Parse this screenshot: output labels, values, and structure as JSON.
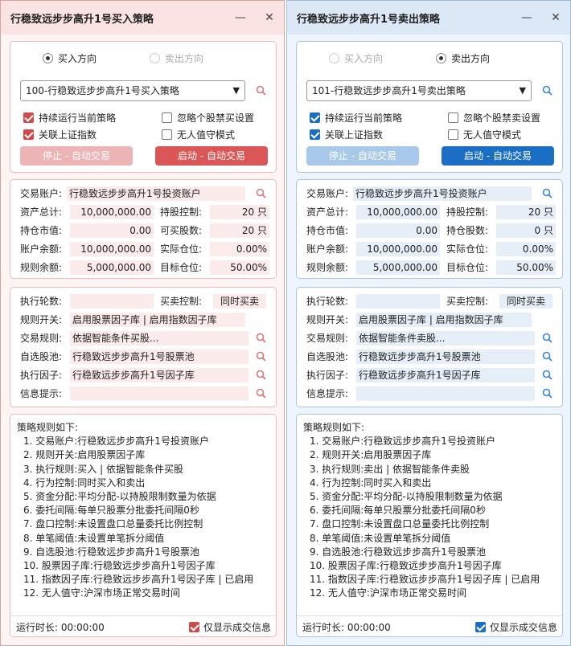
{
  "buy": {
    "title": "行稳致远步步高升1号买入策略",
    "minimize": "—",
    "close": "✕",
    "direction_buy": "买入方向",
    "direction_sell": "卖出方向",
    "strategy_select": "100-行稳致远步步高升1号买入策略",
    "chk_continuous": "持续运行当前策略",
    "chk_ignore": "忽略个股禁买设置",
    "chk_link_index": "关联上证指数",
    "chk_unattended": "无人值守模式",
    "btn_stop": "停止 - 自动交易",
    "btn_start": "启动 - 自动交易",
    "acct_label": "交易账户:",
    "acct_value": "行稳致远步步高升1号投资账户",
    "total_label": "资产总计:",
    "total_value": "10,000,000.00",
    "hold_ctrl_label": "持股控制:",
    "hold_ctrl_value": "20 只",
    "mv_label": "持仓市值:",
    "mv_value": "0.00",
    "avail_label": "可买股数:",
    "avail_value": "20 只",
    "bal_label": "账户余额:",
    "bal_value": "10,000,000.00",
    "actual_label": "实际仓位:",
    "actual_value": "0.00%",
    "rule_bal_label": "规则余额:",
    "rule_bal_value": "5,000,000.00",
    "target_label": "目标仓位:",
    "target_value": "50.00%",
    "rounds_label": "执行轮数:",
    "rounds_value": "",
    "bs_ctrl_label": "买卖控制:",
    "bs_ctrl_value": "同时买卖",
    "switch_label": "规则开关:",
    "switch_value": "启用股票因子库 | 启用指数因子库",
    "trade_rule_label": "交易规则:",
    "trade_rule_value": "依据智能条件买股...",
    "pool_label": "自选股池:",
    "pool_value": "行稳致远步步高升1号股票池",
    "factor_label": "执行因子:",
    "factor_value": "行稳致远步步高升1号因子库",
    "info_label": "信息提示:",
    "info_value": "",
    "rules_header": "策略规则如下:",
    "rules": [
      "1. 交易账户:行稳致远步步高升1号投资账户",
      "2. 规则开关:启用股票因子库",
      "3. 执行规则:买入 | 依据智能条件买股",
      "4. 行为控制:同时买入和卖出",
      "5. 资金分配:平均分配-以持股限制数量为依据",
      "6. 委托间隔:每单只股票分批委托间隔0秒",
      "7. 盘口控制:未设置盘口总量委托比例控制",
      "8. 单笔阈值:未设置单笔拆分阈值",
      "9. 自选股池:行稳致远步步高升1号股票池",
      "10. 股票因子库:行稳致远步步高升1号因子库",
      "11. 指数因子库:行稳致远步步高升1号因子库 | 已启用",
      "12. 无人值守:沪深市场正常交易时间"
    ],
    "runtime": "运行时长: 00:00:00",
    "only_deal": "仅显示成交信息"
  },
  "sell": {
    "title": "行稳致远步步高升1号卖出策略",
    "minimize": "—",
    "close": "✕",
    "direction_buy": "买入方向",
    "direction_sell": "卖出方向",
    "strategy_select": "101-行稳致远步步高升1号卖出策略",
    "chk_continuous": "持续运行当前策略",
    "chk_ignore": "忽略个股禁卖设置",
    "chk_link_index": "关联上证指数",
    "chk_unattended": "无人值守模式",
    "btn_stop": "停止 - 自动交易",
    "btn_start": "启动 - 自动交易",
    "acct_label": "交易账户:",
    "acct_value": "行稳致远步步高升1号投资账户",
    "total_label": "资产总计:",
    "total_value": "10,000,000.00",
    "hold_ctrl_label": "持股控制:",
    "hold_ctrl_value": "20 只",
    "mv_label": "持仓市值:",
    "mv_value": "0.00",
    "avail_label": "持仓股数:",
    "avail_value": "0 只",
    "bal_label": "账户余额:",
    "bal_value": "10,000,000.00",
    "actual_label": "实际仓位:",
    "actual_value": "0.00%",
    "rule_bal_label": "规则余额:",
    "rule_bal_value": "5,000,000.00",
    "target_label": "目标仓位:",
    "target_value": "50.00%",
    "rounds_label": "执行轮数:",
    "rounds_value": "",
    "bs_ctrl_label": "买卖控制:",
    "bs_ctrl_value": "同时买卖",
    "switch_label": "规则开关:",
    "switch_value": "启用股票因子库 | 启用指数因子库",
    "trade_rule_label": "交易规则:",
    "trade_rule_value": "依据智能条件卖股...",
    "pool_label": "自选股池:",
    "pool_value": "行稳致远步步高升1号股票池",
    "factor_label": "执行因子:",
    "factor_value": "行稳致远步步高升1号因子库",
    "info_label": "信息提示:",
    "info_value": "",
    "rules_header": "策略规则如下:",
    "rules": [
      "1. 交易账户:行稳致远步步高升1号投资账户",
      "2. 规则开关:启用股票因子库",
      "3. 执行规则:卖出 | 依据智能条件卖股",
      "4. 行为控制:同时买入和卖出",
      "5. 资金分配:平均分配-以持股限制数量为依据",
      "6. 委托间隔:每单只股票分批委托间隔0秒",
      "7. 盘口控制:未设置盘口总量委托比例控制",
      "8. 单笔阈值:未设置单笔拆分阈值",
      "9. 自选股池:行稳致远步步高升1号股票池",
      "10. 股票因子库:行稳致远步步高升1号因子库",
      "11. 指数因子库:行稳致远步步高升1号因子库 | 已启用",
      "12. 无人值守:沪深市场正常交易时间"
    ],
    "runtime": "运行时长: 00:00:00",
    "only_deal": "仅显示成交信息"
  },
  "colors": {
    "buy_accent": "#db5757",
    "sell_accent": "#1a6fc4"
  }
}
